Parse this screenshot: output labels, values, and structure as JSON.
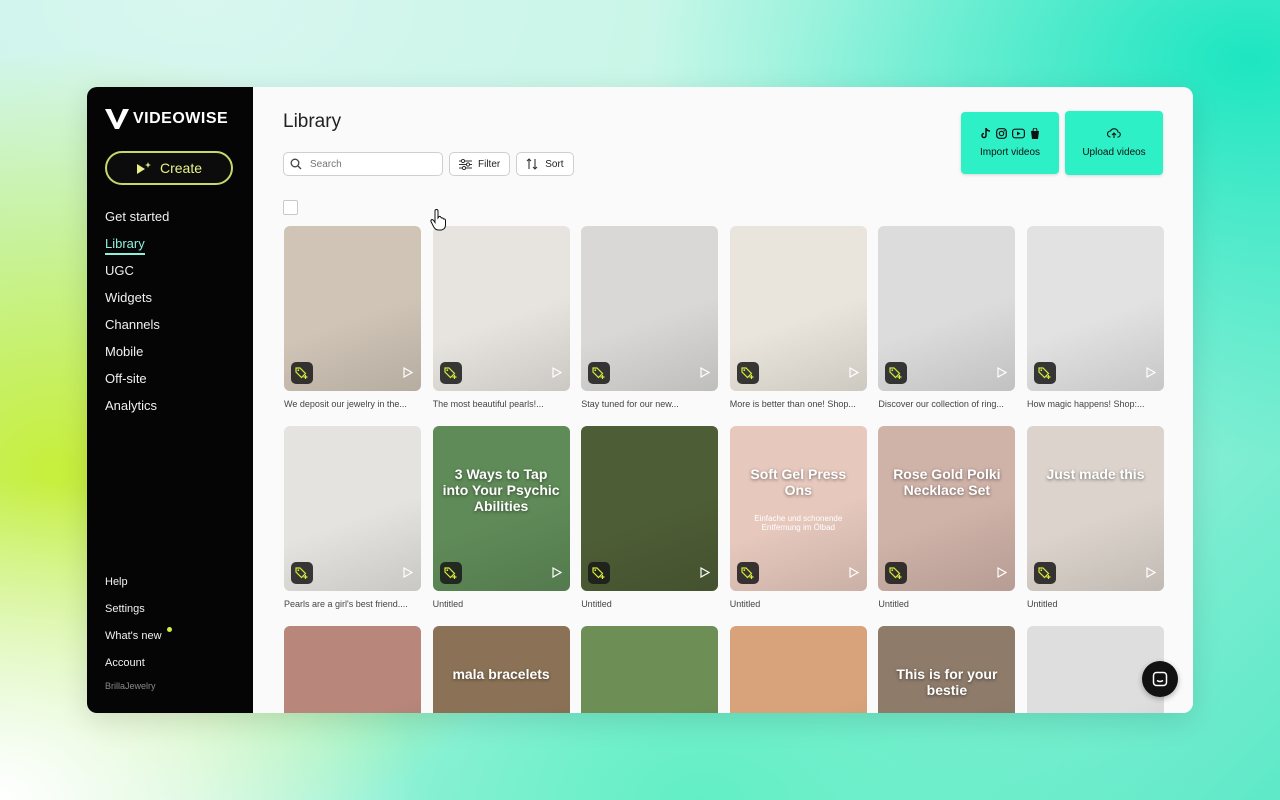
{
  "brand": {
    "name": "VIDEOWISE"
  },
  "create_label": "Create",
  "nav": {
    "items": [
      "Get started",
      "Library",
      "UGC",
      "Widgets",
      "Channels",
      "Mobile",
      "Off-site",
      "Analytics"
    ],
    "active": "Library",
    "bottom": [
      "Help",
      "Settings",
      "What's new",
      "Account"
    ],
    "account_name": "BrillaJewelry"
  },
  "page": {
    "title": "Library"
  },
  "toolbar": {
    "search_placeholder": "Search",
    "filter_label": "Filter",
    "sort_label": "Sort"
  },
  "actions": {
    "import_label": "Import videos",
    "upload_label": "Upload videos",
    "import_icons": [
      "tiktok-icon",
      "instagram-icon",
      "youtube-icon",
      "shopify-icon"
    ]
  },
  "videos": [
    {
      "caption": "We deposit our jewelry in the...",
      "bg": "#cfc4b6"
    },
    {
      "caption": "The most beautiful pearls!...",
      "bg": "#e7e4df"
    },
    {
      "caption": "Stay tuned for our new...",
      "bg": "#d9d8d6"
    },
    {
      "caption": "More is better than one! Shop...",
      "bg": "#e9e5dc"
    },
    {
      "caption": "Discover our collection of ring...",
      "bg": "#dcdcdc"
    },
    {
      "caption": "How magic happens! Shop:...",
      "bg": "#e2e2e2"
    },
    {
      "caption": "Pearls are a girl's best friend....",
      "bg": "#e4e3df"
    },
    {
      "caption": "Untitled",
      "bg": "#5f8b58",
      "overlay": "3 Ways to Tap into Your Psychic Abilities"
    },
    {
      "caption": "Untitled",
      "bg": "#4d5d35"
    },
    {
      "caption": "Untitled",
      "bg": "#e6c8bd",
      "overlay": "Soft Gel Press Ons",
      "overlay_sub": "Einfache und schonende Entfernung im Ölbad"
    },
    {
      "caption": "Untitled",
      "bg": "#cfb2a8",
      "overlay": "Rose Gold Polki Necklace Set"
    },
    {
      "caption": "Untitled",
      "bg": "#dcd4cc",
      "overlay": "Just made this"
    },
    {
      "caption": "",
      "bg": "#b8867a"
    },
    {
      "caption": "",
      "bg": "#8b7256",
      "overlay": "mala bracelets"
    },
    {
      "caption": "",
      "bg": "#6d8f55"
    },
    {
      "caption": "",
      "bg": "#d8a37a"
    },
    {
      "caption": "",
      "bg": "#8e7b6a",
      "overlay": "This is for your bestie"
    },
    {
      "caption": "",
      "bg": "#dedede"
    }
  ],
  "colors": {
    "accent": "#2ef0c6",
    "sidebar_bg": "#050505",
    "create_border": "#c7d86a",
    "active_nav": "#8ef0da"
  }
}
